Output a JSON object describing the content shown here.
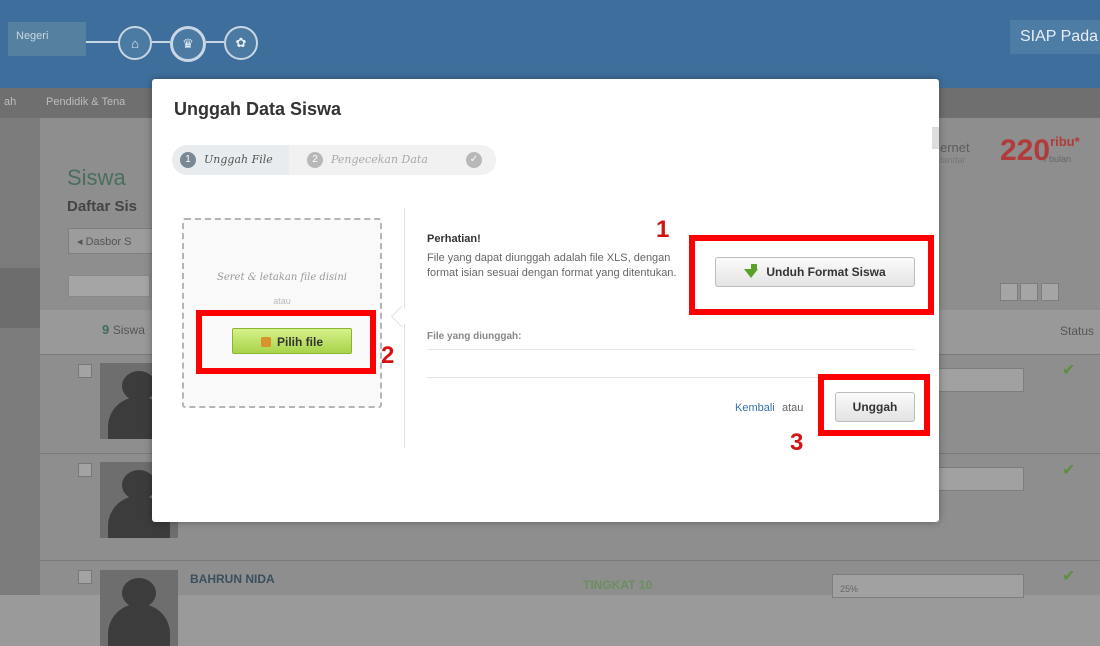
{
  "background": {
    "school_label": "Negeri",
    "brand": "SIAP Pada",
    "subnav": [
      "ah",
      "Pendidik & Tena"
    ],
    "internet_label": "ernet",
    "internet_sub": "tandar",
    "price": "220",
    "price_unit": "ribu*",
    "price_period": "/ bulan",
    "page_title": "Siswa",
    "page_subtitle": "Daftar Sis",
    "dasbor_label": "◂ Dasbor S",
    "student_count": "9",
    "student_count_label": "Siswa",
    "status_header": "Status",
    "student_name": "BAHRUN NIDA",
    "student_level": "TINGKAT 10",
    "student_progress": "25%"
  },
  "modal": {
    "title": "Unggah Data Siswa",
    "steps": [
      {
        "num": "1",
        "label": "Unggah File"
      },
      {
        "num": "2",
        "label": "Pengecekan Data"
      },
      {
        "num": "✓",
        "label": ""
      }
    ],
    "dropzone_text": "Seret & letakan file disini",
    "dropzone_or": "atau",
    "choose_file_button": "Pilih file",
    "notice_title": "Perhatian!",
    "notice_text": "File yang dapat diunggah adalah file XLS, dengan format isian sesuai dengan format yang ditentukan.",
    "download_button": "Unduh Format Siswa",
    "uploaded_label": "File yang diunggah:",
    "back_link": "Kembali",
    "or_text": "atau",
    "upload_button": "Unggah"
  },
  "annotations": [
    "1",
    "2",
    "3"
  ],
  "colors": {
    "highlight": "#ff0000",
    "choose_file_green": "#a8d34a",
    "download_arrow": "#5aa128",
    "link": "#3c72a6"
  }
}
